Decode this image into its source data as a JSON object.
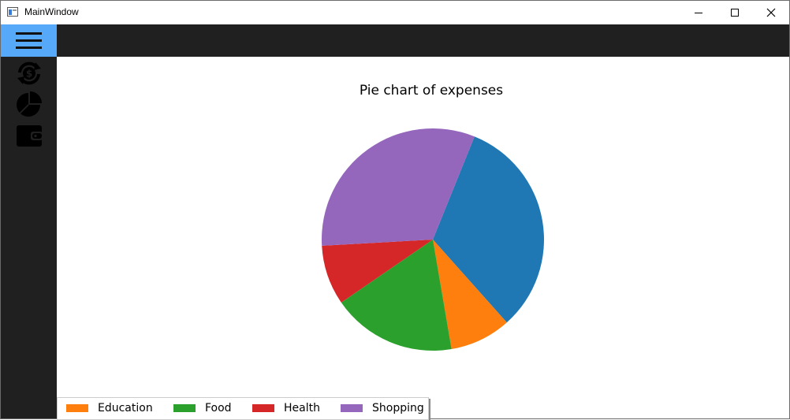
{
  "window": {
    "title": "MainWindow"
  },
  "sidebar": {
    "items": [
      {
        "icon": "menu-icon"
      },
      {
        "icon": "currency-exchange-icon"
      },
      {
        "icon": "pie-chart-icon"
      },
      {
        "icon": "wallet-icon"
      }
    ]
  },
  "colors": {
    "sidebar_bg": "#202020",
    "menu_active": "#56a9f9",
    "Education": "#ff7f0e",
    "Food": "#2ca02c",
    "Health": "#d62728",
    "Shopping": "#9467bd",
    "Unlabeled": "#1f77b4"
  },
  "chart_data": {
    "type": "pie",
    "title": "Pie chart of expenses",
    "slices": [
      {
        "name": "",
        "value": 32.3,
        "color": "#1f77b4"
      },
      {
        "name": "Education",
        "value": 8.9,
        "color": "#ff7f0e"
      },
      {
        "name": "Food",
        "value": 18.1,
        "color": "#2ca02c"
      },
      {
        "name": "Health",
        "value": 8.7,
        "color": "#d62728"
      },
      {
        "name": "Shopping",
        "value": 32.0,
        "color": "#9467bd"
      }
    ],
    "legend": [
      "Education",
      "Food",
      "Health",
      "Shopping"
    ],
    "legend_position": "bottom-left"
  }
}
